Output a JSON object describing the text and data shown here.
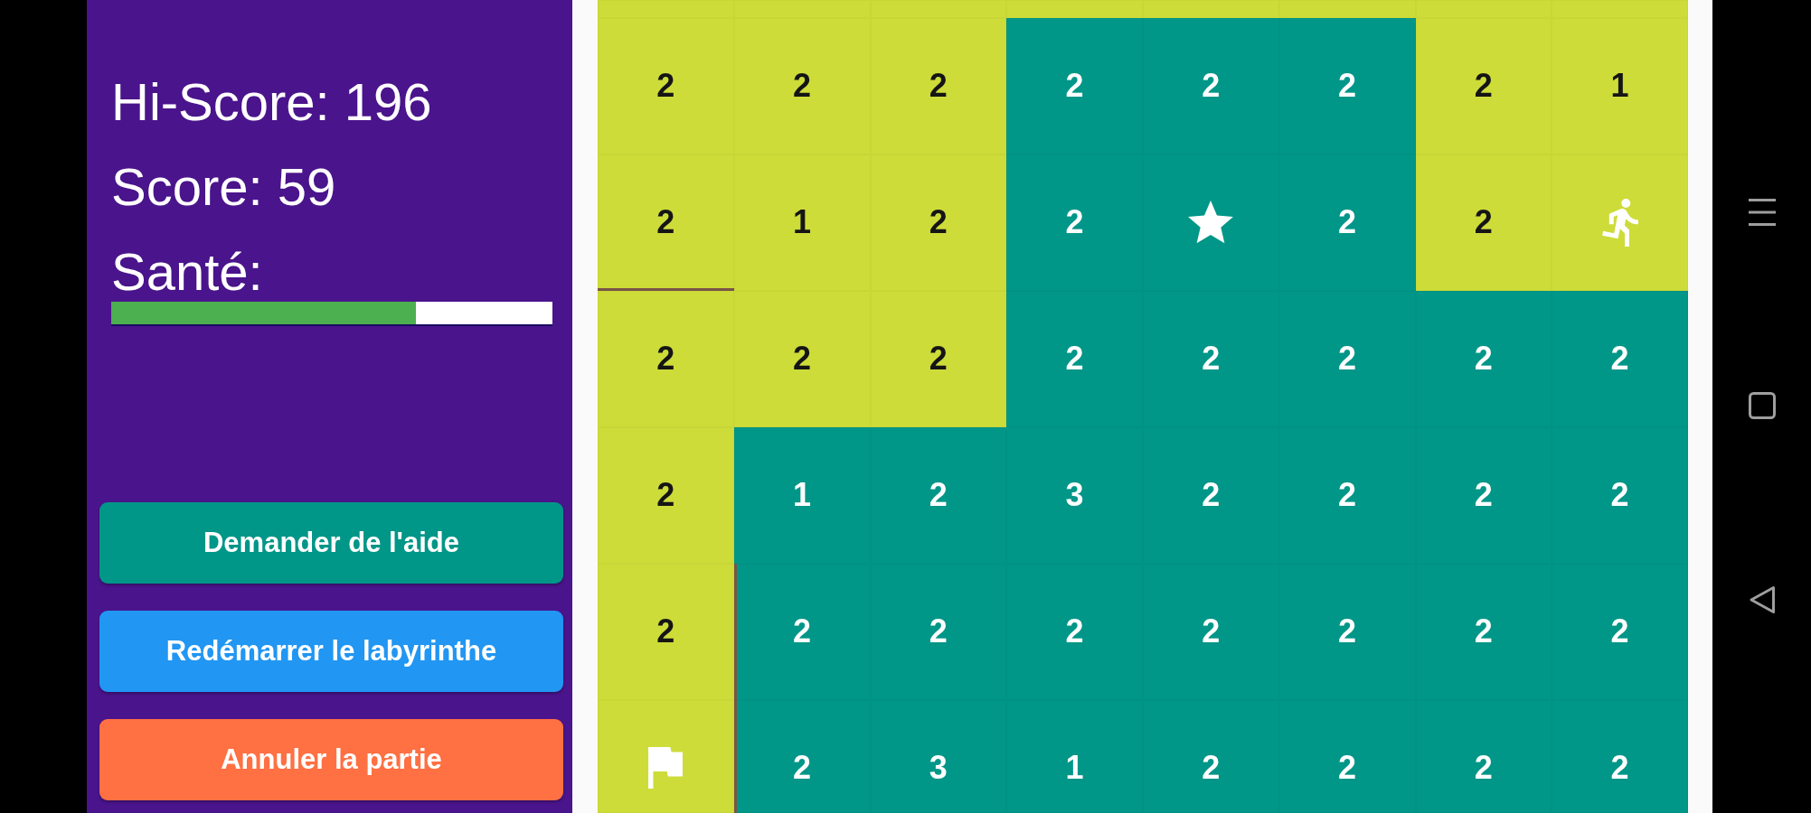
{
  "hi_score": "Hi-Score: 196",
  "score": "Score: 59",
  "health": {
    "label": "Santé:",
    "level": 0.69
  },
  "buttons": [
    {
      "label": "Demander de l'aide",
      "color": "#009688"
    },
    {
      "label": "Redémarrer le labyrinthe",
      "color": "#2196f3"
    },
    {
      "label": "Annuler la partie",
      "color": "#ff7043"
    }
  ],
  "grid": {
    "rows": [
      {
        "cells": [
          {
            "kind": "blank",
            "visited": true,
            "wall_bottom": false,
            "wall_left": false
          },
          {
            "kind": "blank",
            "visited": true,
            "wall_bottom": false,
            "wall_left": false
          },
          {
            "kind": "blank",
            "visited": true,
            "wall_bottom": false,
            "wall_left": false
          },
          {
            "kind": "blank",
            "visited": true,
            "wall_bottom": false,
            "wall_left": false
          },
          {
            "kind": "blank",
            "visited": true,
            "wall_bottom": false,
            "wall_left": false
          },
          {
            "kind": "blank",
            "visited": true,
            "wall_bottom": false,
            "wall_left": false
          },
          {
            "kind": "blank",
            "visited": true,
            "wall_bottom": false,
            "wall_left": false
          },
          {
            "kind": "blank",
            "visited": true,
            "wall_bottom": false,
            "wall_left": false
          }
        ]
      },
      {
        "cells": [
          {
            "kind": "number",
            "text": "2",
            "visited": true,
            "wall_bottom": false,
            "wall_left": false
          },
          {
            "kind": "number",
            "text": "2",
            "visited": true,
            "wall_bottom": false,
            "wall_left": false
          },
          {
            "kind": "number",
            "text": "2",
            "visited": true,
            "wall_bottom": false,
            "wall_left": false
          },
          {
            "kind": "number",
            "text": "2",
            "visited": false,
            "wall_bottom": false,
            "wall_left": false
          },
          {
            "kind": "number",
            "text": "2",
            "visited": false,
            "wall_bottom": false,
            "wall_left": false
          },
          {
            "kind": "number",
            "text": "2",
            "visited": false,
            "wall_bottom": false,
            "wall_left": false
          },
          {
            "kind": "number",
            "text": "2",
            "visited": true,
            "wall_bottom": false,
            "wall_left": false
          },
          {
            "kind": "number",
            "text": "1",
            "visited": true,
            "wall_bottom": false,
            "wall_left": false
          }
        ]
      },
      {
        "cells": [
          {
            "kind": "number",
            "text": "2",
            "visited": true,
            "wall_bottom": true,
            "wall_left": false
          },
          {
            "kind": "number",
            "text": "1",
            "visited": true,
            "wall_bottom": false,
            "wall_left": false
          },
          {
            "kind": "number",
            "text": "2",
            "visited": true,
            "wall_bottom": false,
            "wall_left": false
          },
          {
            "kind": "number",
            "text": "2",
            "visited": false,
            "wall_bottom": false,
            "wall_left": false
          },
          {
            "kind": "star",
            "visited": false,
            "wall_bottom": false,
            "wall_left": false
          },
          {
            "kind": "number",
            "text": "2",
            "visited": false,
            "wall_bottom": false,
            "wall_left": false
          },
          {
            "kind": "number",
            "text": "2",
            "visited": true,
            "wall_bottom": false,
            "wall_left": false
          },
          {
            "kind": "player",
            "visited": true,
            "wall_bottom": false,
            "wall_left": false
          }
        ]
      },
      {
        "cells": [
          {
            "kind": "number",
            "text": "2",
            "visited": true,
            "wall_bottom": false,
            "wall_left": false
          },
          {
            "kind": "number",
            "text": "2",
            "visited": true,
            "wall_bottom": false,
            "wall_left": false
          },
          {
            "kind": "number",
            "text": "2",
            "visited": true,
            "wall_bottom": false,
            "wall_left": false
          },
          {
            "kind": "number",
            "text": "2",
            "visited": false,
            "wall_bottom": false,
            "wall_left": false
          },
          {
            "kind": "number",
            "text": "2",
            "visited": false,
            "wall_bottom": false,
            "wall_left": false
          },
          {
            "kind": "number",
            "text": "2",
            "visited": false,
            "wall_bottom": false,
            "wall_left": false
          },
          {
            "kind": "number",
            "text": "2",
            "visited": false,
            "wall_bottom": false,
            "wall_left": false
          },
          {
            "kind": "number",
            "text": "2",
            "visited": false,
            "wall_bottom": false,
            "wall_left": false
          }
        ]
      },
      {
        "cells": [
          {
            "kind": "number",
            "text": "2",
            "visited": true,
            "wall_bottom": false,
            "wall_left": false
          },
          {
            "kind": "number",
            "text": "1",
            "visited": false,
            "wall_bottom": false,
            "wall_left": false
          },
          {
            "kind": "number",
            "text": "2",
            "visited": false,
            "wall_bottom": false,
            "wall_left": false
          },
          {
            "kind": "number",
            "text": "3",
            "visited": false,
            "wall_bottom": false,
            "wall_left": false
          },
          {
            "kind": "number",
            "text": "2",
            "visited": false,
            "wall_bottom": false,
            "wall_left": false
          },
          {
            "kind": "number",
            "text": "2",
            "visited": false,
            "wall_bottom": false,
            "wall_left": false
          },
          {
            "kind": "number",
            "text": "2",
            "visited": false,
            "wall_bottom": false,
            "wall_left": false
          },
          {
            "kind": "number",
            "text": "2",
            "visited": false,
            "wall_bottom": false,
            "wall_left": false
          }
        ]
      },
      {
        "cells": [
          {
            "kind": "number",
            "text": "2",
            "visited": true,
            "wall_bottom": false,
            "wall_left": false
          },
          {
            "kind": "number",
            "text": "2",
            "visited": false,
            "wall_bottom": false,
            "wall_left": true
          },
          {
            "kind": "number",
            "text": "2",
            "visited": false,
            "wall_bottom": false,
            "wall_left": false
          },
          {
            "kind": "number",
            "text": "2",
            "visited": false,
            "wall_bottom": false,
            "wall_left": false
          },
          {
            "kind": "number",
            "text": "2",
            "visited": false,
            "wall_bottom": false,
            "wall_left": false
          },
          {
            "kind": "number",
            "text": "2",
            "visited": false,
            "wall_bottom": false,
            "wall_left": false
          },
          {
            "kind": "number",
            "text": "2",
            "visited": false,
            "wall_bottom": false,
            "wall_left": false
          },
          {
            "kind": "number",
            "text": "2",
            "visited": false,
            "wall_bottom": false,
            "wall_left": false
          }
        ]
      },
      {
        "cells": [
          {
            "kind": "flag",
            "visited": true,
            "wall_bottom": false,
            "wall_left": false
          },
          {
            "kind": "number",
            "text": "2",
            "visited": false,
            "wall_bottom": false,
            "wall_left": true
          },
          {
            "kind": "number",
            "text": "3",
            "visited": false,
            "wall_bottom": false,
            "wall_left": false
          },
          {
            "kind": "number",
            "text": "1",
            "visited": false,
            "wall_bottom": false,
            "wall_left": false
          },
          {
            "kind": "number",
            "text": "2",
            "visited": false,
            "wall_bottom": false,
            "wall_left": false
          },
          {
            "kind": "number",
            "text": "2",
            "visited": false,
            "wall_bottom": false,
            "wall_left": false
          },
          {
            "kind": "number",
            "text": "2",
            "visited": false,
            "wall_bottom": false,
            "wall_left": false
          },
          {
            "kind": "number",
            "text": "2",
            "visited": false,
            "wall_bottom": false,
            "wall_left": false
          }
        ]
      }
    ]
  }
}
